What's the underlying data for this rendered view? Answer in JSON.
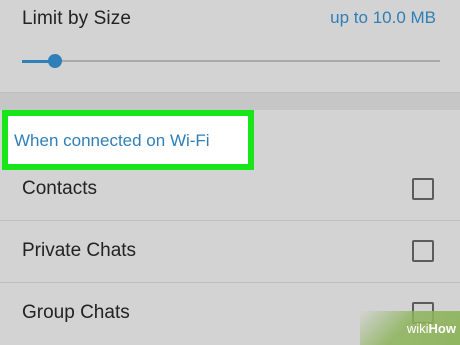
{
  "size_limit": {
    "label": "Limit by Size",
    "value": "up to 10.0 MB",
    "slider_level_percent": 8
  },
  "wifi_section": {
    "header": "When connected on Wi-Fi",
    "items": [
      {
        "label": "Contacts",
        "checked": false
      },
      {
        "label": "Private Chats",
        "checked": false
      },
      {
        "label": "Group Chats",
        "checked": false
      }
    ]
  },
  "colors": {
    "accent": "#2f7fb8",
    "highlight": "#19e619",
    "background": "#d3d3d3"
  },
  "watermark": {
    "wiki": "wiki",
    "how": "How"
  }
}
